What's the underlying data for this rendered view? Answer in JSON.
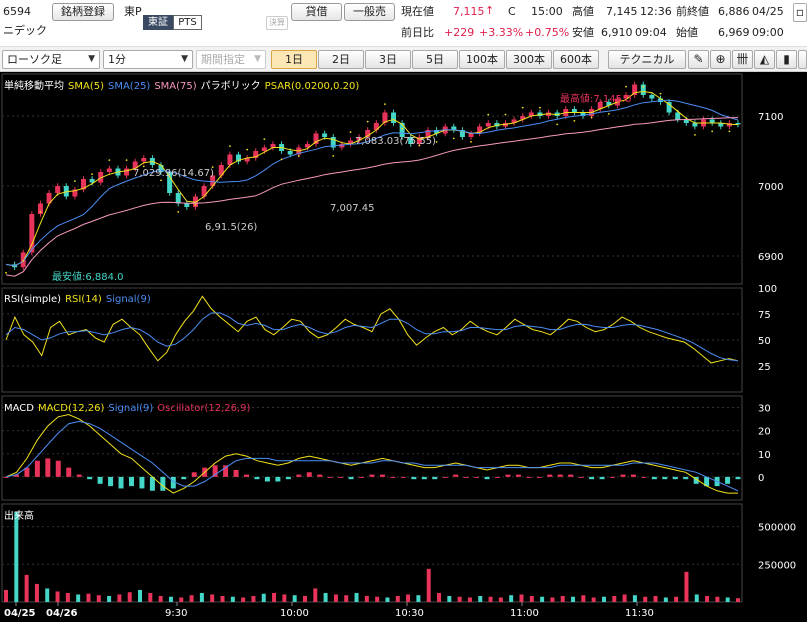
{
  "header": {
    "code": "6594",
    "name": "ニデック",
    "register_button": "銘柄登録",
    "market_label": "東P",
    "market_tab_tse": "東証",
    "market_tab_pts": "PTS",
    "settlement_label": "決算",
    "credit_button": "貸借",
    "general_button": "一般売",
    "current_price_label": "現在値",
    "current_price": "7,115",
    "current_price_flag": "C",
    "current_time": "15:00",
    "high_label": "高値",
    "high_value": "7,145",
    "high_time": "12:36",
    "prev_close_label": "前終値",
    "prev_close_value": "6,886",
    "prev_close_date": "04/25",
    "change_label": "前日比",
    "change_value": "+229",
    "change_pct": "+3.33%",
    "change_extra": "+0.75%",
    "low_label": "安値",
    "low_value": "6,910",
    "low_time": "09:04",
    "open_label": "始値",
    "open_value": "6,969",
    "open_time": "09:00"
  },
  "toolbar": {
    "chart_type": "ローソク足",
    "interval": "1分",
    "period": "期間指定",
    "ranges": [
      "1日",
      "2日",
      "3日",
      "5日",
      "100本",
      "300本",
      "600本"
    ],
    "active_range": "1日",
    "technical_button": "テクニカル"
  },
  "colors": {
    "up": "#e8335a",
    "down": "#44d6c6",
    "sma5": "#f2e21a",
    "sma25": "#4c8df5",
    "sma75": "#f79ac0",
    "psar": "#f2e21a",
    "signal": "#4c8df5",
    "grid": "#555555",
    "axis_text": "#ffffff"
  },
  "legends": {
    "main": {
      "title": "単純移動平均",
      "sma5": "SMA(5)",
      "sma25": "SMA(25)",
      "sma75": "SMA(75)",
      "psar_title": "パラボリック",
      "psar": "PSAR(0.0200,0.20)"
    },
    "rsi": {
      "title": "RSI(simple)",
      "rsi": "RSI(14)",
      "signal": "Signal(9)"
    },
    "macd": {
      "title": "MACD",
      "macd": "MACD(12,26)",
      "signal": "Signal(9)",
      "osc": "Oscillator(12,26,9)"
    },
    "volume": {
      "title": "出来高"
    }
  },
  "chart_data": [
    {
      "type": "candlestick",
      "panel": "price",
      "yticks": [
        "7100",
        "7000",
        "6900"
      ],
      "ylim": [
        6860,
        7160
      ],
      "annotations": [
        "最高値:7,145.0",
        "最安値:6,884.0",
        "7,029.96(14.67)",
        "7,083.03(75.55)",
        "7,007.45",
        "6,91.5(26)"
      ],
      "series_price": [
        6888,
        6884,
        6905,
        6960,
        6975,
        6990,
        7000,
        6985,
        6995,
        7010,
        7005,
        7020,
        7025,
        7015,
        7025,
        7035,
        7040,
        7030,
        7020,
        6990,
        6975,
        6970,
        6985,
        7000,
        7015,
        7030,
        7045,
        7035,
        7040,
        7050,
        7055,
        7060,
        7050,
        7045,
        7055,
        7060,
        7075,
        7070,
        7055,
        7060,
        7065,
        7070,
        7080,
        7090,
        7105,
        7090,
        7070,
        7060,
        7070,
        7080,
        7075,
        7085,
        7080,
        7070,
        7075,
        7085,
        7090,
        7085,
        7090,
        7095,
        7100,
        7105,
        7100,
        7105,
        7100,
        7110,
        7105,
        7100,
        7110,
        7120,
        7115,
        7125,
        7130,
        7145,
        7130,
        7125,
        7120,
        7105,
        7095,
        7090,
        7085,
        7095,
        7090,
        7085,
        7090,
        7088
      ]
    },
    {
      "type": "line",
      "panel": "rsi",
      "yticks": [
        "100",
        "75",
        "50",
        "25"
      ],
      "ylim": [
        0,
        100
      ],
      "series": [
        {
          "name": "RSI(14)",
          "values": [
            50,
            72,
            55,
            48,
            35,
            62,
            68,
            55,
            58,
            60,
            52,
            48,
            65,
            70,
            62,
            55,
            42,
            30,
            38,
            55,
            68,
            78,
            92,
            80,
            72,
            65,
            58,
            68,
            72,
            60,
            55,
            62,
            70,
            68,
            58,
            52,
            55,
            62,
            70,
            65,
            62,
            58,
            75,
            80,
            70,
            55,
            45,
            52,
            58,
            62,
            55,
            60,
            68,
            62,
            58,
            55,
            62,
            70,
            65,
            60,
            58,
            55,
            62,
            70,
            68,
            62,
            58,
            60,
            65,
            72,
            68,
            62,
            58,
            55,
            52,
            50,
            48,
            42,
            35,
            28,
            30,
            32,
            30
          ]
        },
        {
          "name": "Signal(9)",
          "values": [
            55,
            62,
            60,
            55,
            50,
            52,
            56,
            58,
            58,
            59,
            57,
            55,
            57,
            60,
            62,
            60,
            55,
            48,
            44,
            46,
            52,
            60,
            70,
            76,
            76,
            72,
            66,
            64,
            66,
            64,
            60,
            60,
            63,
            65,
            62,
            58,
            56,
            58,
            62,
            64,
            63,
            62,
            66,
            70,
            70,
            66,
            60,
            56,
            56,
            58,
            58,
            59,
            62,
            62,
            61,
            60,
            60,
            63,
            64,
            63,
            62,
            60,
            60,
            63,
            65,
            65,
            63,
            62,
            62,
            64,
            65,
            64,
            62,
            60,
            57,
            54,
            51,
            47,
            42,
            37,
            33,
            31,
            30
          ]
        }
      ]
    },
    {
      "type": "line",
      "panel": "macd",
      "yticks": [
        "30",
        "20",
        "10",
        "0"
      ],
      "ylim": [
        -10,
        35
      ],
      "series": [
        {
          "name": "MACD(12,26)",
          "values": [
            0,
            2,
            8,
            16,
            22,
            26,
            27,
            25,
            22,
            18,
            14,
            10,
            8,
            4,
            0,
            -4,
            -7,
            -5,
            -2,
            2,
            6,
            9,
            10,
            9,
            7,
            6,
            5,
            6,
            8,
            9,
            8,
            7,
            6,
            5,
            6,
            7,
            8,
            7,
            6,
            5,
            4,
            4,
            5,
            6,
            5,
            4,
            3,
            4,
            5,
            5,
            4,
            4,
            5,
            6,
            6,
            5,
            4,
            4,
            5,
            6,
            7,
            6,
            5,
            4,
            3,
            2,
            -1,
            -4,
            -6,
            -7,
            -7
          ]
        },
        {
          "name": "Signal(9)",
          "values": [
            0,
            1,
            4,
            9,
            14,
            19,
            23,
            24,
            23,
            21,
            18,
            15,
            12,
            9,
            6,
            2,
            -2,
            -4,
            -4,
            -2,
            1,
            4,
            7,
            8,
            8,
            8,
            7,
            7,
            7,
            7,
            7,
            7,
            6,
            6,
            6,
            6,
            7,
            7,
            6,
            6,
            5,
            5,
            5,
            5,
            5,
            4,
            4,
            4,
            4,
            4,
            4,
            4,
            4,
            5,
            5,
            5,
            5,
            5,
            5,
            5,
            6,
            6,
            6,
            5,
            4,
            3,
            2,
            0,
            -2,
            -4,
            -6
          ]
        },
        {
          "name": "Oscillator(12,26,9)",
          "values": [
            0,
            1,
            4,
            7,
            8,
            7,
            4,
            1,
            -1,
            -3,
            -4,
            -5,
            -4,
            -5,
            -6,
            -6,
            -5,
            -1,
            2,
            4,
            5,
            5,
            3,
            1,
            -1,
            -2,
            -2,
            -1,
            1,
            2,
            1,
            0,
            0,
            -1,
            0,
            1,
            1,
            0,
            0,
            -1,
            -1,
            -1,
            0,
            1,
            0,
            0,
            -1,
            0,
            1,
            1,
            0,
            0,
            1,
            1,
            1,
            0,
            -1,
            -1,
            0,
            1,
            1,
            0,
            -1,
            -1,
            -1,
            -1,
            -3,
            -4,
            -4,
            -3,
            -1
          ]
        }
      ]
    },
    {
      "type": "bar",
      "panel": "volume",
      "yticks": [
        "500000",
        "250000"
      ],
      "ylim": [
        0,
        650000
      ],
      "values": [
        80000,
        600000,
        180000,
        120000,
        90000,
        70000,
        60000,
        50000,
        55000,
        45000,
        40000,
        50000,
        65000,
        80000,
        60000,
        40000,
        35000,
        30000,
        45000,
        60000,
        50000,
        40000,
        35000,
        30000,
        40000,
        55000,
        60000,
        50000,
        45000,
        40000,
        90000,
        60000,
        50000,
        45000,
        60000,
        40000,
        35000,
        30000,
        40000,
        50000,
        45000,
        220000,
        60000,
        40000,
        35000,
        30000,
        40000,
        35000,
        30000,
        45000,
        50000,
        40000,
        35000,
        30000,
        40000,
        35000,
        45000,
        30000,
        35000,
        40000,
        50000,
        45000,
        35000,
        40000,
        30000,
        35000,
        200000,
        50000,
        40000,
        35000,
        30000,
        25000
      ]
    }
  ],
  "xaxis": {
    "labels": [
      "04/25",
      "04/26",
      "9:30",
      "10:00",
      "10:30",
      "11:00",
      "11:30"
    ]
  }
}
